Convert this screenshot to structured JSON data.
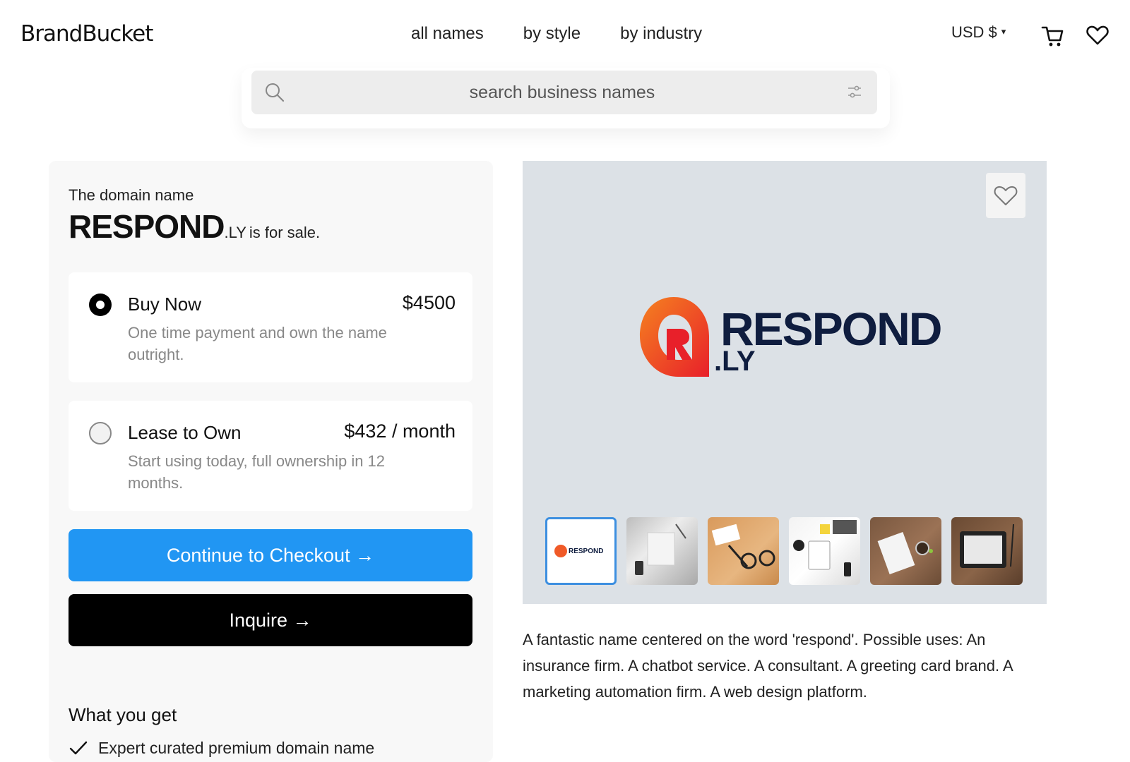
{
  "header": {
    "logo": "BrandBucket",
    "nav": [
      "all names",
      "by style",
      "by industry"
    ],
    "currency": "USD $",
    "currency_caret": "▾"
  },
  "search": {
    "placeholder": "search business names"
  },
  "listing": {
    "intro": "The domain name",
    "name": "RESPOND",
    "tld": ".LY",
    "suffix": "is for sale.",
    "options": [
      {
        "title": "Buy Now",
        "price": "$4500",
        "description": "One time payment and own the name outright.",
        "selected": true
      },
      {
        "title": "Lease to Own",
        "price": "$432 / month",
        "description": "Start using today, full ownership in 12 months.",
        "selected": false
      }
    ],
    "checkout_label": "Continue to Checkout →",
    "inquire_label": "Inquire →",
    "what_you_get_title": "What you get",
    "what_you_get_items": [
      "Expert curated premium domain name"
    ]
  },
  "preview": {
    "brand_word": "RESPOND",
    "brand_tld": ".LY",
    "thumb_logo_text": "RESPOND",
    "accent_colors": {
      "logo_orange": "#f05a28",
      "logo_red": "#e8202a",
      "logo_navy": "#0f1d3f",
      "preview_bg": "#dce1e6"
    }
  },
  "description": "A fantastic name centered on the word 'respond'. Possible uses: An insurance firm. A chatbot service. A consultant. A greeting card brand. A marketing automation firm. A web design platform.",
  "colors": {
    "checkout_button": "#2196f3",
    "inquire_button": "#000000"
  },
  "icons": [
    "search-icon",
    "filter-icon",
    "cart-icon",
    "heart-icon",
    "check-icon"
  ]
}
